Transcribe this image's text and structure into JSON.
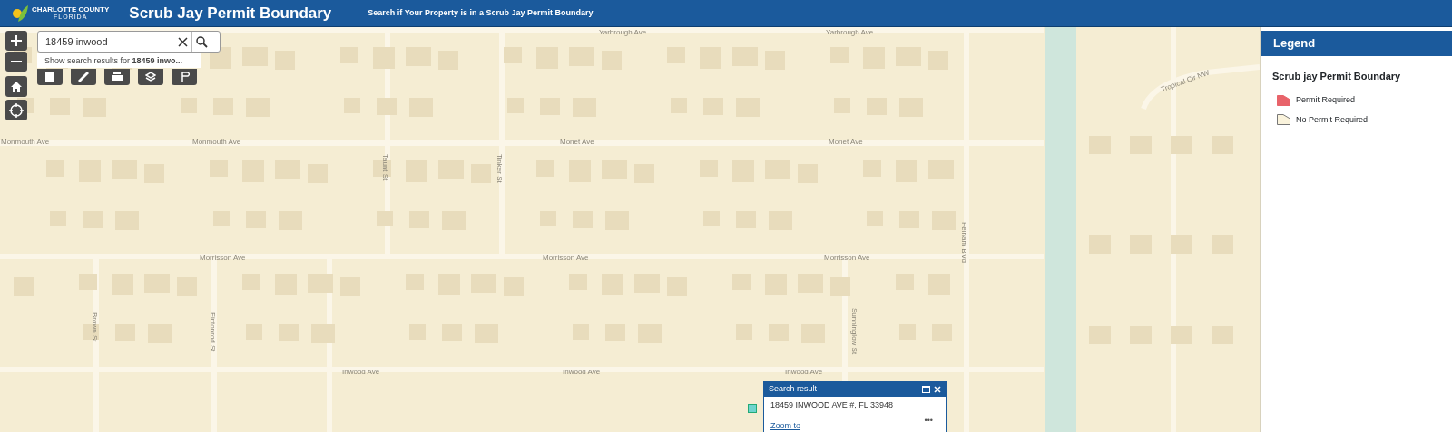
{
  "header": {
    "logo_line_1": "CHARLOTTE COUNTY",
    "logo_line_2": "FLORIDA",
    "title": "Scrub Jay Permit Boundary",
    "subtitle": "Search if Your Property is in a Scrub Jay Permit Boundary"
  },
  "search": {
    "value": "18459 inwood",
    "suggestion": "Show search results for **18459 inwo...**"
  },
  "map_labels": [
    {
      "text": "Yarbrough Ave",
      "kind": "horizontal"
    },
    {
      "text": "Yarbrough Ave",
      "kind": "horizontal"
    },
    {
      "text": "Monmouth Ave",
      "kind": "horizontal"
    },
    {
      "text": "Monmouth Ave",
      "kind": "horizontal"
    },
    {
      "text": "Monet Ave",
      "kind": "horizontal"
    },
    {
      "text": "Monet Ave",
      "kind": "horizontal"
    },
    {
      "text": "Taunt St",
      "kind": "vertical"
    },
    {
      "text": "Tinker St",
      "kind": "vertical"
    },
    {
      "text": "Tropical Cir NW",
      "kind": "diagonal"
    },
    {
      "text": "Pelham Blvd",
      "kind": "vertical"
    },
    {
      "text": "Morrisson Ave",
      "kind": "horizontal"
    },
    {
      "text": "Morrisson Ave",
      "kind": "horizontal"
    },
    {
      "text": "Morrisson Ave",
      "kind": "horizontal"
    },
    {
      "text": "Brown St",
      "kind": "vertical"
    },
    {
      "text": "Fintonrod St",
      "kind": "vertical"
    },
    {
      "text": "Sunninglow St",
      "kind": "vertical"
    },
    {
      "text": "Inwood Ave",
      "kind": "horizontal"
    },
    {
      "text": "Inwood Ave",
      "kind": "horizontal"
    },
    {
      "text": "Inwood Ave",
      "kind": "horizontal"
    }
  ],
  "legend": {
    "title": "Legend",
    "layer": "Scrub jay Permit Boundary",
    "items": [
      {
        "label": "Permit Required",
        "color": "#e8636a"
      },
      {
        "label": "No Permit Required",
        "color": "#faf3dc"
      }
    ]
  },
  "popup": {
    "title": "Search result",
    "address": "18459 INWOOD AVE #, FL 33948",
    "link": "Zoom to",
    "more": "•••"
  }
}
